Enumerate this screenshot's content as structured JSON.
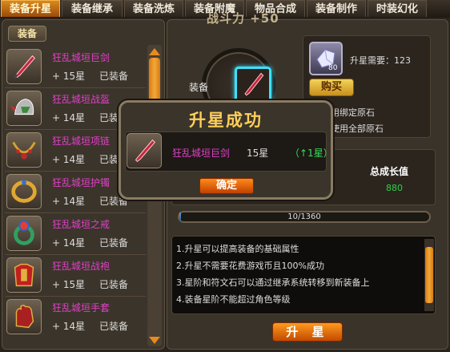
{
  "tabs": [
    {
      "label": "装备升星",
      "active": true
    },
    {
      "label": "装备继承",
      "active": false
    },
    {
      "label": "装备洗炼",
      "active": false
    },
    {
      "label": "装备附魔",
      "active": false
    },
    {
      "label": "物品合成",
      "active": false
    },
    {
      "label": "装备制作",
      "active": false
    },
    {
      "label": "时装幻化",
      "active": false
    }
  ],
  "left": {
    "header": "装备",
    "items": [
      {
        "name": "狂乱城垣巨剑",
        "level": "+ 15星",
        "status": "已装备",
        "icon": "sword-icon"
      },
      {
        "name": "狂乱城垣战盔",
        "level": "+ 14星",
        "status": "已装备",
        "icon": "helmet-icon"
      },
      {
        "name": "狂乱城垣项链",
        "level": "+ 14星",
        "status": "已装备",
        "icon": "necklace-icon"
      },
      {
        "name": "狂乱城垣护镯",
        "level": "+ 14星",
        "status": "已装备",
        "icon": "bracelet-icon"
      },
      {
        "name": "狂乱城垣之戒",
        "level": "+ 14星",
        "status": "已装备",
        "icon": "ring-icon"
      },
      {
        "name": "狂乱城垣战袍",
        "level": "+ 15星",
        "status": "已装备",
        "icon": "armor-icon"
      },
      {
        "name": "狂乱城垣手套",
        "level": "+ 14星",
        "status": "已装备",
        "icon": "glove-icon"
      }
    ]
  },
  "right": {
    "power": "战斗力 +50",
    "equip_label": "装备",
    "stone_count": "80",
    "requirement": "升星需要：123",
    "buy": "购买",
    "option1": "使用绑定原石",
    "option2": "次使用全部原石",
    "growth_label": "总成长值",
    "growth_value": "880",
    "progress_text": "10/1360",
    "progress_fraction": 0.0074,
    "tips": [
      "1.升星可以提高装备的基础属性",
      "2.升星不需要花费游戏币且100%成功",
      "3.星阶和符文石可以通过继承系统转移到新装备上",
      "4.装备星阶不能超过角色等级"
    ],
    "upgrade_button": "升 星"
  },
  "dialog": {
    "title": "升星成功",
    "item_name": "狂乱城垣巨剑",
    "item_level": "15星",
    "gain": "（↑1星）",
    "confirm": "确定"
  },
  "colors": {
    "accent_orange": "#e0841a",
    "item_name": "#e040c8",
    "growth_green": "#2fd04a",
    "slot_highlight": "#3fe0ff"
  }
}
